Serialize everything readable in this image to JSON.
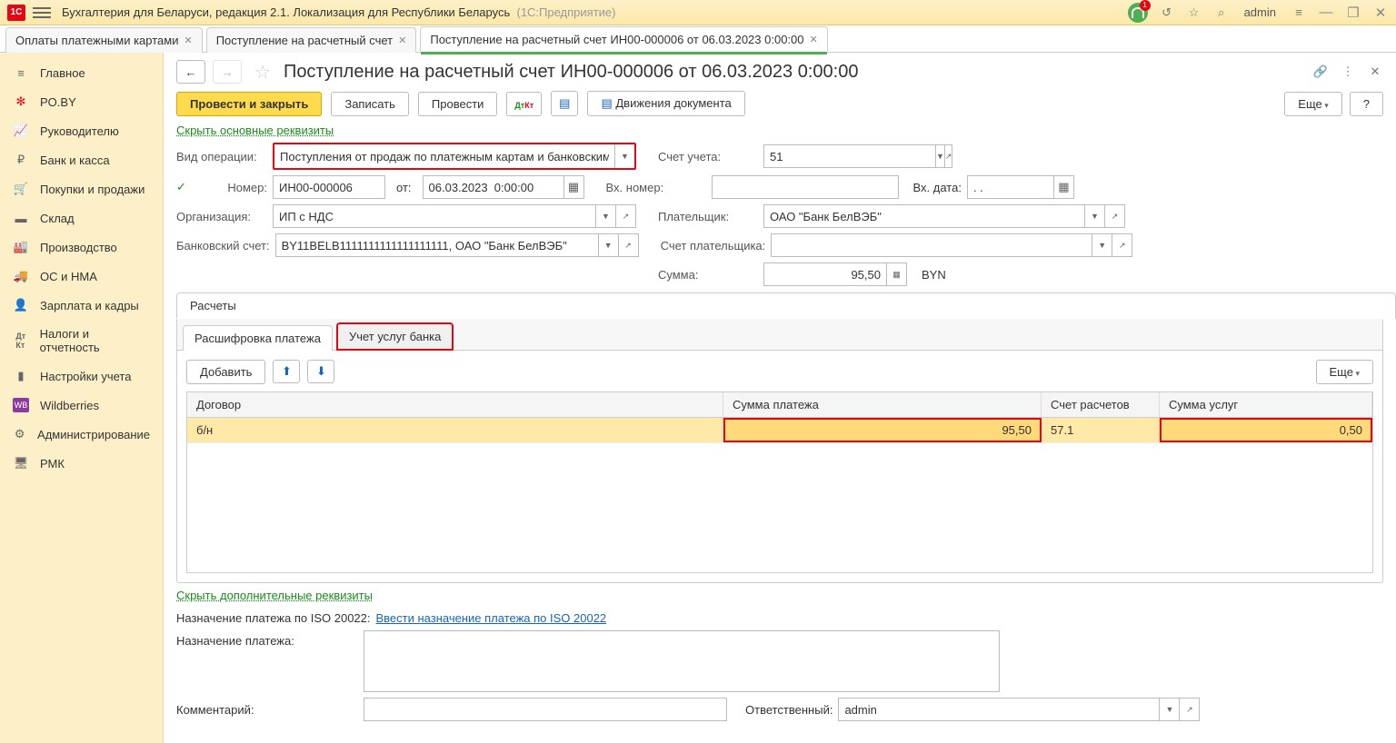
{
  "titlebar": {
    "app": "Бухгалтерия для Беларуси, редакция 2.1. Локализация для Республики Беларусь",
    "platform": "(1С:Предприятие)",
    "user": "admin",
    "bell_badge": "1"
  },
  "tabs": [
    {
      "label": "Оплаты платежными картами"
    },
    {
      "label": "Поступление на расчетный счет"
    },
    {
      "label": "Поступление на расчетный счет ИН00-000006 от 06.03.2023 0:00:00",
      "active": true
    }
  ],
  "sidebar": [
    {
      "label": "Главное"
    },
    {
      "label": "PO.BY"
    },
    {
      "label": "Руководителю"
    },
    {
      "label": "Банк и касса"
    },
    {
      "label": "Покупки и продажи"
    },
    {
      "label": "Склад"
    },
    {
      "label": "Производство"
    },
    {
      "label": "ОС и НМА"
    },
    {
      "label": "Зарплата и кадры"
    },
    {
      "label": "Налоги и отчетность"
    },
    {
      "label": "Настройки учета"
    },
    {
      "label": "Wildberries"
    },
    {
      "label": "Администрирование"
    },
    {
      "label": "РМК"
    }
  ],
  "page": {
    "title": "Поступление на расчетный счет ИН00-000006 от 06.03.2023 0:00:00",
    "btn_primary": "Провести и закрыть",
    "btn_save": "Записать",
    "btn_post": "Провести",
    "btn_movements": "Движения документа",
    "btn_more": "Еще",
    "btn_help": "?",
    "link_hide_main": "Скрыть основные реквизиты",
    "link_hide_extra": "Скрыть дополнительные реквизиты"
  },
  "form": {
    "op_label": "Вид операции:",
    "op_value": "Поступления от продаж по платежным картам и банковским креди",
    "acct_label": "Счет учета:",
    "acct_value": "51",
    "num_label": "Номер:",
    "num_value": "ИН00-000006",
    "from_label": "от:",
    "date_value": "06.03.2023  0:00:00",
    "inc_num_label": "Вх. номер:",
    "inc_num_value": "",
    "inc_date_label": "Вх. дата:",
    "inc_date_value": ". .",
    "org_label": "Организация:",
    "org_value": "ИП с НДС",
    "payer_label": "Плательщик:",
    "payer_value": "ОАО \"Банк БелВЭБ\"",
    "bank_label": "Банковский счет:",
    "bank_value": "BY11BELB1111111111111111111, ОАО \"Банк БелВЭБ\"",
    "payer_acct_label": "Счет плательщика:",
    "payer_acct_value": "",
    "sum_label": "Сумма:",
    "sum_value": "95,50",
    "currency": "BYN"
  },
  "tabs2": {
    "outer": "Расчеты",
    "inner1": "Расшифровка платежа",
    "inner2": "Учет услуг банка",
    "btn_add": "Добавить",
    "btn_more": "Еще"
  },
  "grid": {
    "h1": "Договор",
    "h2": "Сумма платежа",
    "h3": "Счет расчетов",
    "h4": "Сумма услуг",
    "rows": [
      {
        "c1": "б/н",
        "c2": "95,50",
        "c3": "57.1",
        "c4": "0,50"
      }
    ]
  },
  "footer": {
    "iso_label": "Назначение платежа по ISO 20022:",
    "iso_link": "Ввести назначение платежа по ISO 20022",
    "purpose_label": "Назначение платежа:",
    "comment_label": "Комментарий:",
    "resp_label": "Ответственный:",
    "resp_value": "admin"
  }
}
